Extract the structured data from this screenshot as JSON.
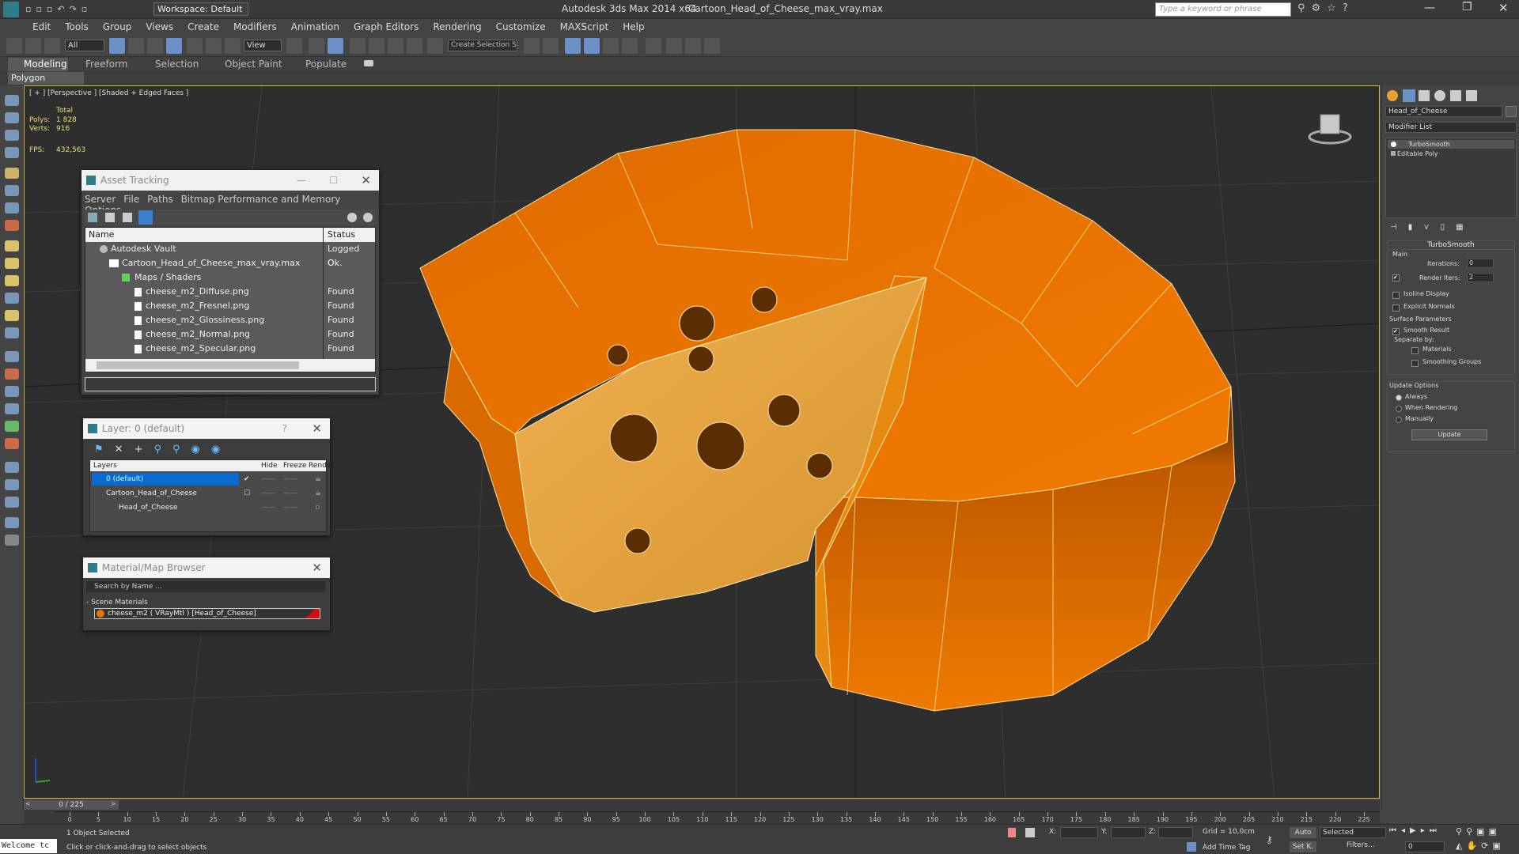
{
  "titlebar": {
    "workspace": "Workspace: Default",
    "app_title": "Autodesk 3ds Max  2014 x64",
    "file_title": "Cartoon_Head_of_Cheese_max_vray.max",
    "search_placeholder": "Type a keyword or phrase"
  },
  "menu": [
    "Edit",
    "Tools",
    "Group",
    "Views",
    "Create",
    "Modifiers",
    "Animation",
    "Graph Editors",
    "Rendering",
    "Customize",
    "MAXScript",
    "Help"
  ],
  "toolbar": {
    "filter_value": "All",
    "view_value": "View",
    "selection_set_placeholder": "Create Selection S"
  },
  "ribbon": {
    "tabs": [
      "Modeling",
      "Freeform",
      "Selection",
      "Object Paint",
      "Populate"
    ],
    "sub_label": "Polygon Modeling"
  },
  "viewport": {
    "label": "[ + ] [Perspective ] [Shaded + Edged Faces ]",
    "stats_total": "Total",
    "polys_label": "Polys:",
    "polys_value": "1 828",
    "verts_label": "Verts:",
    "verts_value": "916",
    "fps_label": "FPS:",
    "fps_value": "432,563"
  },
  "asset_tracking": {
    "title": "Asset Tracking",
    "menu": [
      "Server",
      "File",
      "Paths",
      "Bitmap Performance and Memory",
      "Options"
    ],
    "col_name": "Name",
    "col_status": "Status",
    "rows": [
      {
        "name": "Autodesk Vault",
        "status": "Logged O..."
      },
      {
        "name": "Cartoon_Head_of_Cheese_max_vray.max",
        "status": "Ok"
      },
      {
        "name": "Maps / Shaders",
        "status": ""
      },
      {
        "name": "cheese_m2_Diffuse.png",
        "status": "Found"
      },
      {
        "name": "cheese_m2_Fresnel.png",
        "status": "Found"
      },
      {
        "name": "cheese_m2_Glossiness.png",
        "status": "Found"
      },
      {
        "name": "cheese_m2_Normal.png",
        "status": "Found"
      },
      {
        "name": "cheese_m2_Specular.png",
        "status": "Found"
      }
    ]
  },
  "layer_window": {
    "title": "Layer: 0 (default)",
    "col_layers": "Layers",
    "col_hide": "Hide",
    "col_freeze": "Freeze",
    "col_render": "Render",
    "rows": [
      {
        "name": "0 (default)"
      },
      {
        "name": "Cartoon_Head_of_Cheese"
      },
      {
        "name": "Head_of_Cheese"
      }
    ]
  },
  "material_browser": {
    "title": "Material/Map Browser",
    "search_placeholder": "Search by Name ...",
    "section": "- Scene Materials",
    "item": "cheese_m2  ( VRayMtl )  [Head_of_Cheese]"
  },
  "cmd_panel": {
    "object_name": "Head_of_Cheese",
    "modifier_list": "Modifier List",
    "stack": [
      "TurboSmooth",
      "Editable Poly"
    ],
    "rollout_title": "TurboSmooth",
    "main_label": "Main",
    "iterations_label": "Iterations:",
    "iterations_value": "0",
    "render_iters_label": "Render Iters:",
    "render_iters_value": "2",
    "isoline": "Isoline Display",
    "explicit_normals": "Explicit Normals",
    "surface_params": "Surface Parameters",
    "smooth_result": "Smooth Result",
    "separate_by": "Separate by:",
    "materials": "Materials",
    "smoothing_groups": "Smoothing Groups",
    "update_options": "Update Options",
    "always": "Always",
    "when_rendering": "When Rendering",
    "manually": "Manually",
    "update_button": "Update"
  },
  "timeline": {
    "frame_display": "0 / 225",
    "ticks": [
      "0",
      "5",
      "10",
      "15",
      "20",
      "25",
      "30",
      "35",
      "40",
      "45",
      "50",
      "55",
      "60",
      "65",
      "70",
      "75",
      "80",
      "85",
      "90",
      "95",
      "100",
      "105",
      "110",
      "115",
      "120",
      "125",
      "130",
      "135",
      "140",
      "145",
      "150",
      "155",
      "160",
      "165",
      "170",
      "175",
      "180",
      "185",
      "190",
      "195",
      "200",
      "205",
      "210",
      "215",
      "220",
      "225"
    ]
  },
  "status": {
    "welcome": "Welcome tc",
    "selected_text": "1 Object Selected",
    "prompt": "Click or click-and-drag to select objects",
    "x_label": "X:",
    "y_label": "Y:",
    "z_label": "Z:",
    "grid": "Grid = 10,0cm",
    "add_time_tag": "Add Time Tag",
    "auto": "Auto",
    "set_key": "Set K.",
    "selected_dropdown": "Selected",
    "filters": "Filters...",
    "frame_field": "0"
  },
  "colors": {
    "cheese_rind": "#e87300",
    "cheese_inner": "#e0a040",
    "viewport_bg": "#2e2e2e",
    "selection_blue": "#0a6ad0"
  }
}
